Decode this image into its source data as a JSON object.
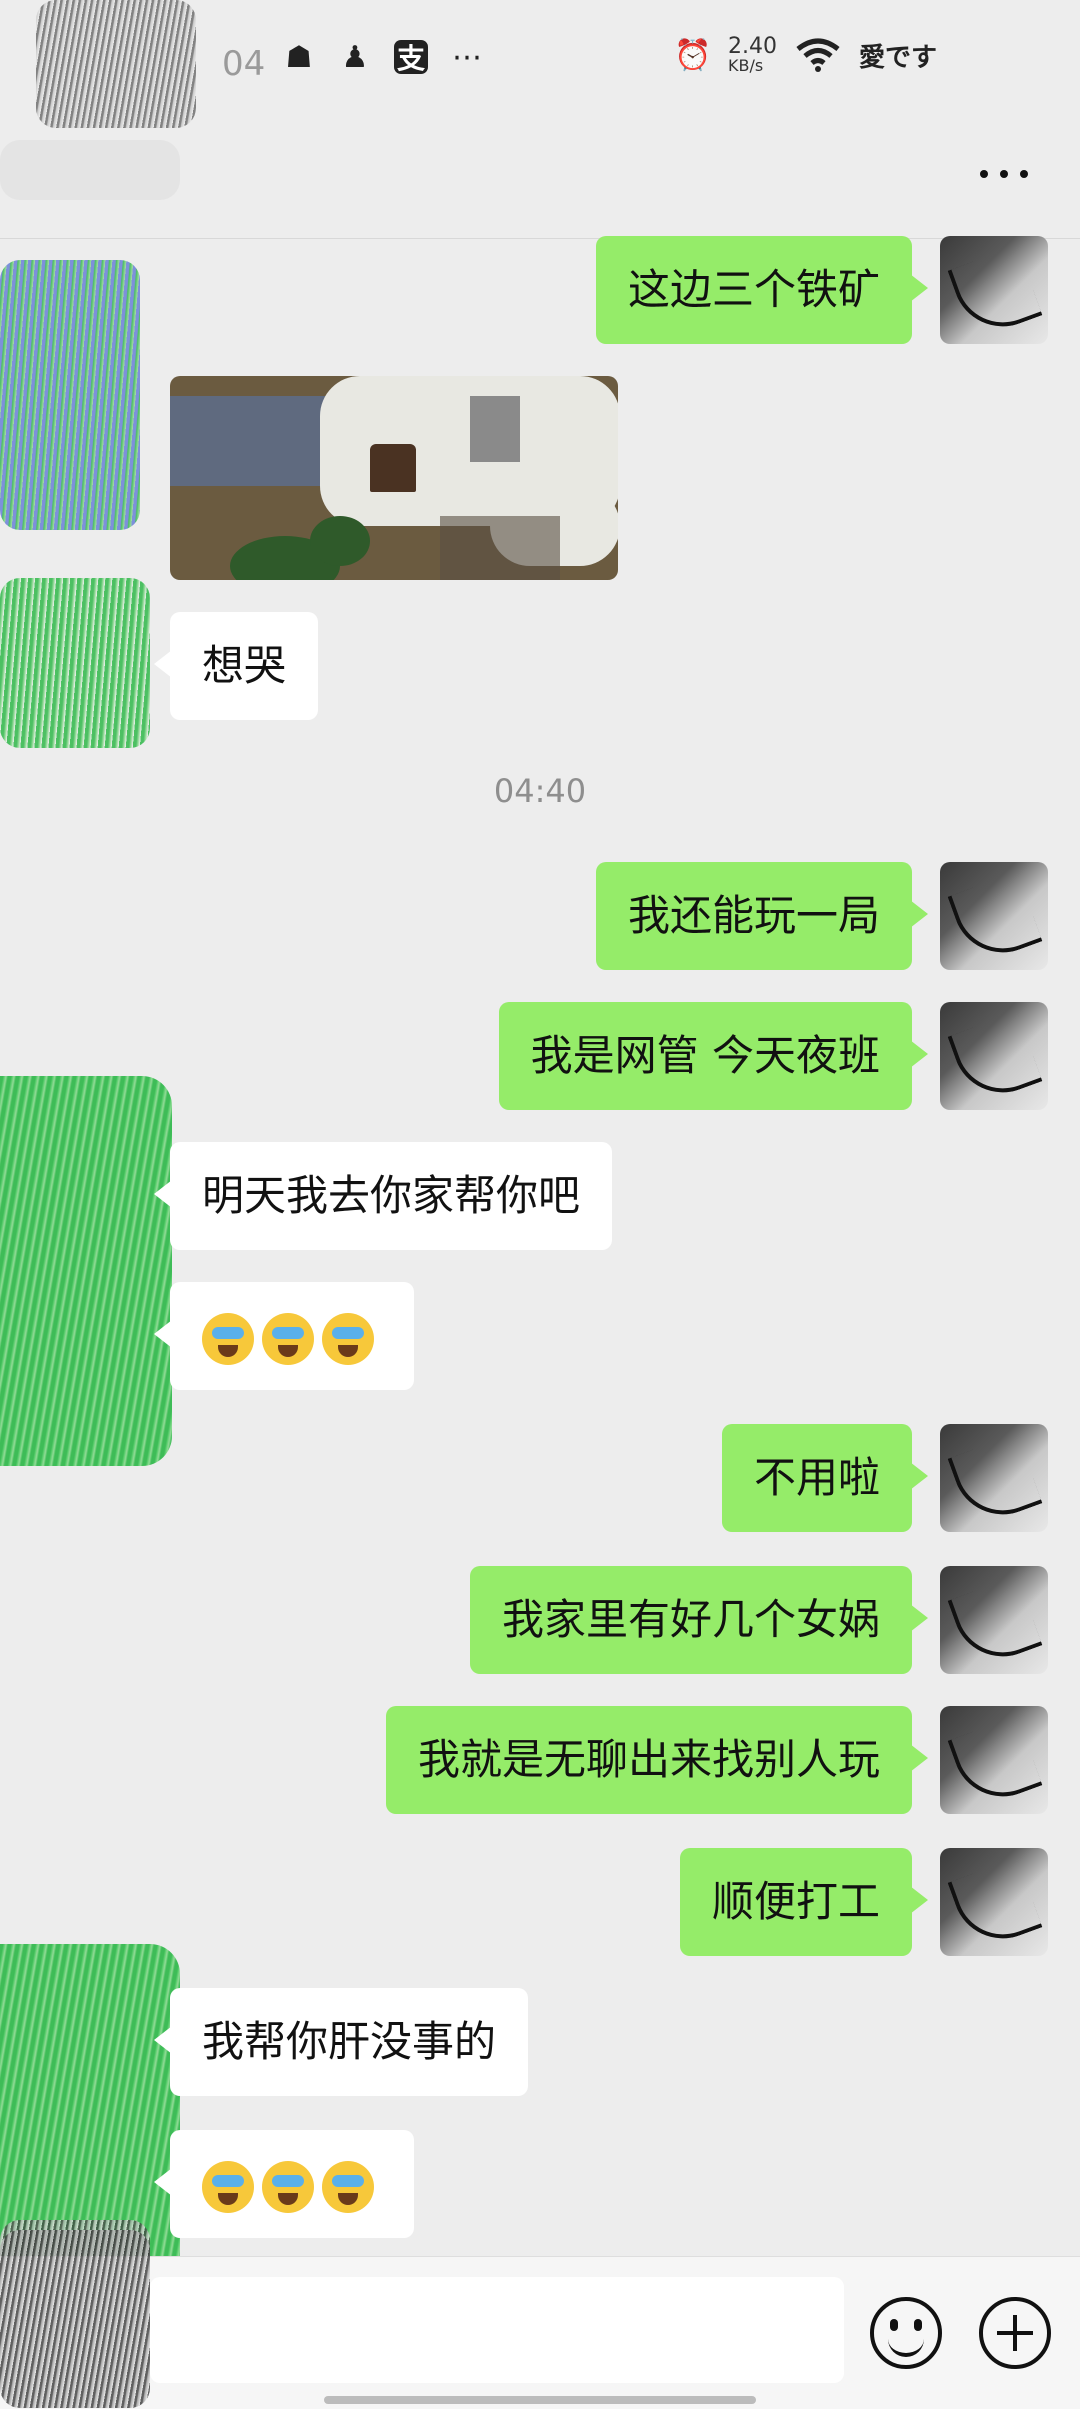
{
  "status_bar": {
    "time": "04",
    "icons": [
      "snapchat-ghost-icon",
      "qq-penguin-icon",
      "alipay-icon",
      "more-dots-icon"
    ],
    "speed_value": "2.40",
    "speed_unit": "KB/s",
    "carrier": "愛です"
  },
  "header": {
    "more_label": "···"
  },
  "messages": {
    "m1": "这边三个铁矿",
    "m2": "想哭",
    "timestamp": "04:40",
    "m3": "我还能玩一局",
    "m4": "我是网管 今天夜班",
    "m5": "明天我去你家帮你吧",
    "m7": "不用啦",
    "m8": "我家里有好几个女娲",
    "m9": "我就是无聊出来找别人玩",
    "m10": "顺便打工",
    "m11": "我帮你肝没事的"
  },
  "input": {
    "value": "",
    "placeholder": ""
  },
  "colors": {
    "outgoing_bubble": "#95ec69",
    "incoming_bubble": "#ffffff",
    "background": "#ededed"
  }
}
